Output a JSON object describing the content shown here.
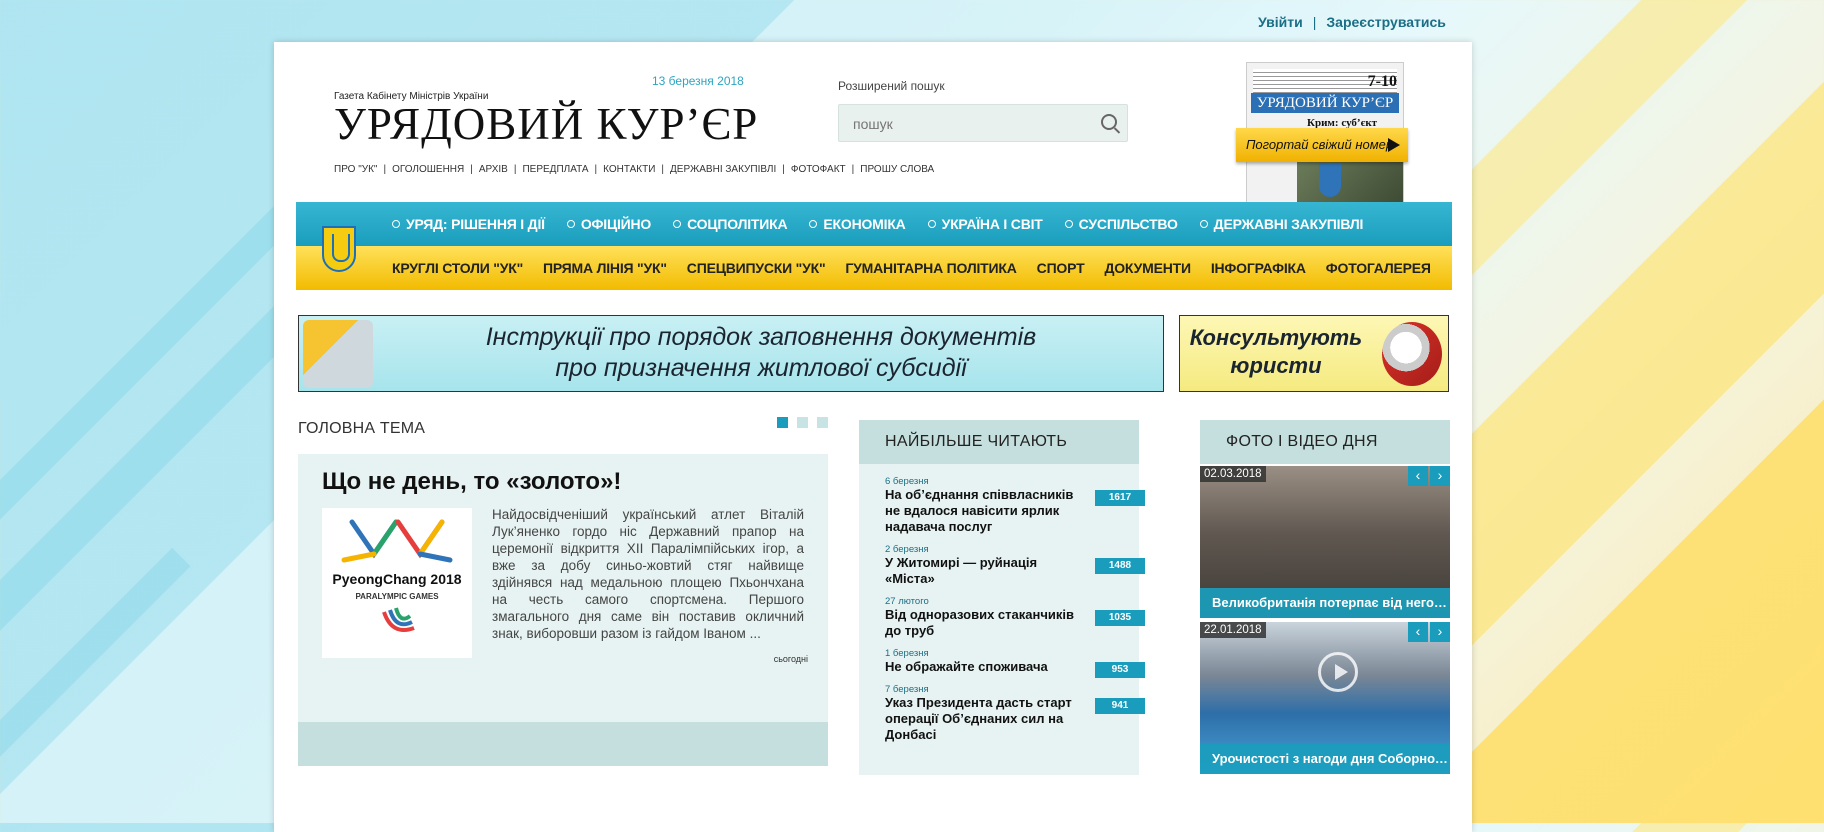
{
  "top_links": {
    "login": "Увійти",
    "separator": "|",
    "register": "Зареєструватись"
  },
  "brand": {
    "subtitle": "Газета Кабінету Міністрів України",
    "logo": "УРЯДОВИЙ КУР’ЄР",
    "date": "13 березня 2018"
  },
  "sublinks": [
    "ПРО \"УК\"",
    "ОГОЛОШЕННЯ",
    "АРХІВ",
    "ПЕРЕДПЛАТА",
    "КОНТАКТИ",
    "ДЕРЖАВНІ ЗАКУПІВЛІ",
    "ФОТОФАКТ",
    "ПРОШУ СЛОВА"
  ],
  "search": {
    "advanced_label": "Розширений пошук",
    "placeholder": "пошук",
    "icon": "search-icon"
  },
  "cover": {
    "pages": "7-10",
    "title": "УРЯДОВИЙ КУР’ЄР",
    "headline": "Крим: суб’єкт",
    "flip_label": "Погортай свіжий номер"
  },
  "nav": {
    "primary": [
      "УРЯД: РІШЕННЯ І ДІЇ",
      "ОФІЦІЙНО",
      "СОЦПОЛІТИКА",
      "ЕКОНОМІКА",
      "УКРАЇНА І СВІТ",
      "СУСПІЛЬСТВО",
      "ДЕРЖАВНІ ЗАКУПІВЛІ"
    ],
    "secondary": [
      "КРУГЛІ СТОЛИ \"УК\"",
      "ПРЯМА ЛІНІЯ \"УК\"",
      "СПЕЦВИПУСКИ \"УК\"",
      "ГУМАНІТАРНА ПОЛІТИКА",
      "СПОРТ",
      "ДОКУМЕНТИ",
      "ІНФОГРАФІКА",
      "ФОТОГАЛЕРЕЯ"
    ]
  },
  "banners": {
    "subsidy_line1": "Інструкції про порядок заповнення документів",
    "subsidy_line2": "про призначення житлової субсидії",
    "lawyers_line1": "Консультують",
    "lawyers_line2": "юристи"
  },
  "main_topic": {
    "section_title": "ГОЛОВНА ТЕМА",
    "title": "Що не день, то «золото»!",
    "lede": "Найдосвідченіший український атлет Віталій Лук’яненко гордо ніс Державний прапор на церемонії відкриття ХІІ Паралімпійських ігор, а вже за добу синьо-жовтий стяг найвище здійнявся над медальною площею Пхьончхана на честь самого спортсмена. Першого змагального дня саме він поставив окличний знак, виборовши разом із гайдом Іваном ...",
    "time": "сьогодні",
    "thumb_title": "PyeongChang 2018",
    "thumb_sub": "PARALYMPIC GAMES"
  },
  "most_read": {
    "title": "НАЙБІЛЬШЕ ЧИТАЮТЬ",
    "items": [
      {
        "date": "6 березня",
        "title": "На об’єднання співвласників не вдалося навісити ярлик надавача послуг",
        "count": "1617"
      },
      {
        "date": "2 березня",
        "title": "У Житомирі — руйнація «Міста»",
        "count": "1488"
      },
      {
        "date": "27 лютого",
        "title": "Від одноразових стаканчиків до труб",
        "count": "1035"
      },
      {
        "date": "1 березня",
        "title": "Не ображайте споживача",
        "count": "953"
      },
      {
        "date": "7 березня",
        "title": "Указ Президента дасть старт операції Об’єднаних сил на Донбасі",
        "count": "941"
      }
    ]
  },
  "photo_video": {
    "title": "ФОТО І ВІДЕО ДНЯ",
    "items": [
      {
        "date": "02.03.2018",
        "caption": "Великобританія потерпає від негоди"
      },
      {
        "date": "22.01.2018",
        "caption": "Урочистості з нагоди дня Соборності ..."
      }
    ],
    "prev": "‹",
    "next": "›"
  }
}
